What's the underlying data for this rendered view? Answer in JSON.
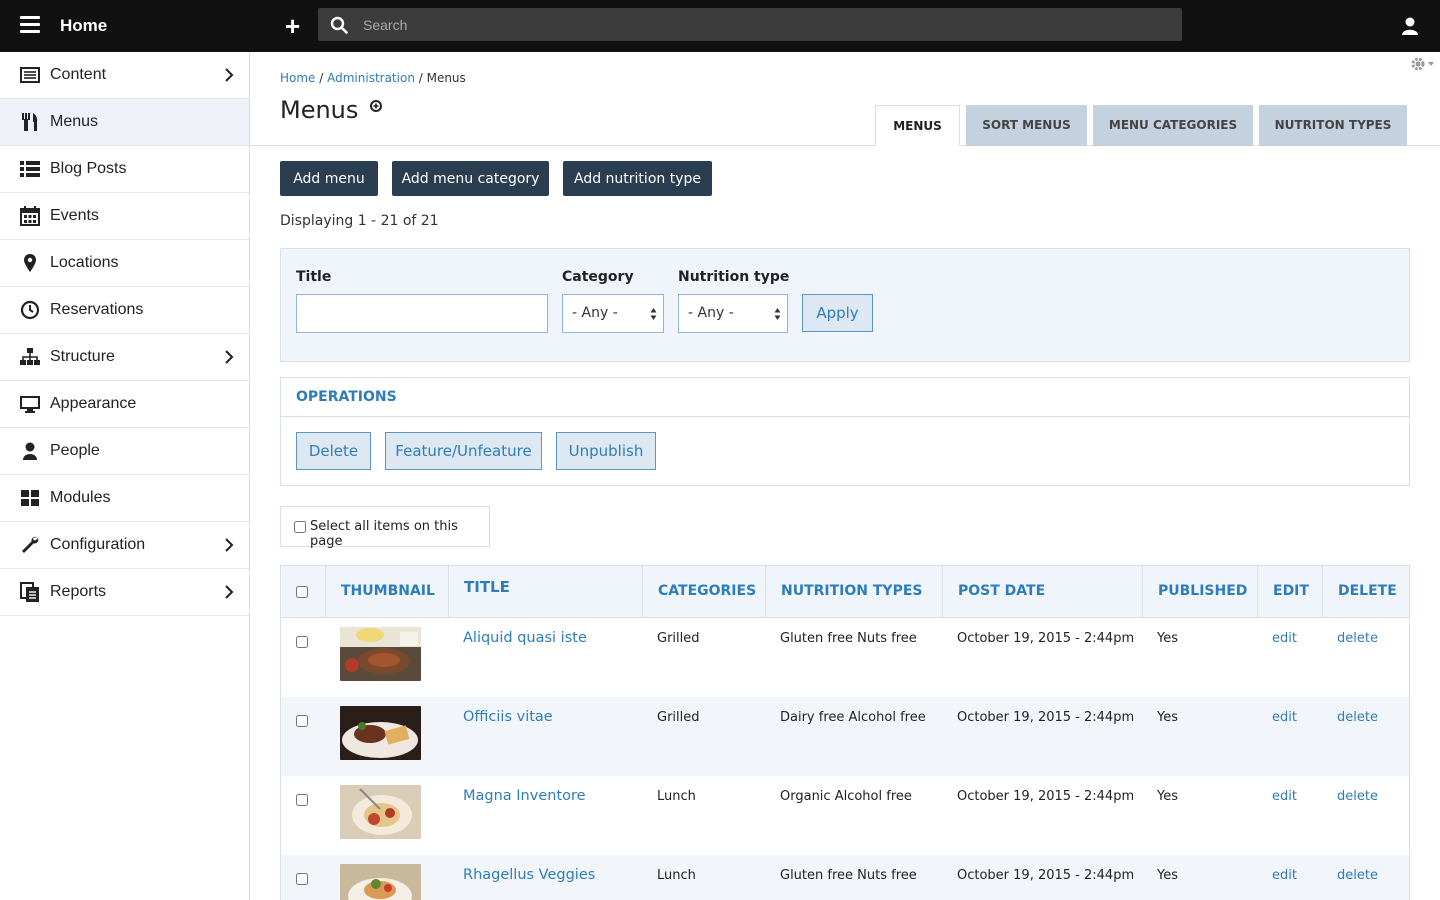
{
  "topbar": {
    "home_label": "Home",
    "search_placeholder": "Search"
  },
  "sidebar": {
    "items": [
      {
        "label": "Content",
        "icon": "content-icon",
        "has_children": true
      },
      {
        "label": "Menus",
        "icon": "menus-icon",
        "active": true
      },
      {
        "label": "Blog Posts",
        "icon": "list-icon"
      },
      {
        "label": "Events",
        "icon": "calendar-icon"
      },
      {
        "label": "Locations",
        "icon": "map-pin-icon"
      },
      {
        "label": "Reservations",
        "icon": "clock-icon"
      },
      {
        "label": "Structure",
        "icon": "sitemap-icon",
        "has_children": true
      },
      {
        "label": "Appearance",
        "icon": "monitor-icon"
      },
      {
        "label": "People",
        "icon": "person-icon"
      },
      {
        "label": "Modules",
        "icon": "modules-icon"
      },
      {
        "label": "Configuration",
        "icon": "wrench-icon",
        "has_children": true
      },
      {
        "label": "Reports",
        "icon": "reports-icon",
        "has_children": true
      }
    ]
  },
  "breadcrumb": {
    "home": "Home",
    "sep1": " / ",
    "admin": "Administration",
    "sep2": " / ",
    "current": "Menus"
  },
  "page_title": "Menus",
  "tabs": [
    {
      "label": "MENUS",
      "active": true
    },
    {
      "label": "SORT MENUS"
    },
    {
      "label": "MENU CATEGORIES"
    },
    {
      "label": "NUTRITON TYPES"
    }
  ],
  "actions": {
    "add_menu": "Add menu",
    "add_menu_category": "Add menu category",
    "add_nutrition_type": "Add nutrition type"
  },
  "displaying": "Displaying 1 - 21 of 21",
  "filters": {
    "title_label": "Title",
    "title_value": "",
    "category_label": "Category",
    "category_value": "- Any -",
    "nutrition_label": "Nutrition type",
    "nutrition_value": "- Any -",
    "apply": "Apply"
  },
  "operations": {
    "title": "OPERATIONS",
    "delete": "Delete",
    "feature": "Feature/Unfeature",
    "unpublish": "Unpublish"
  },
  "select_all": "Select all items on this page",
  "table": {
    "headers": {
      "thumbnail": "THUMBNAIL",
      "title": "TITLE",
      "categories": "CATEGORIES",
      "nutrition": "NUTRITION TYPES",
      "post_date": "POST DATE",
      "published": "PUBLISHED",
      "edit": "EDIT",
      "delete": "DELETE"
    },
    "rows": [
      {
        "title": "Aliquid quasi iste",
        "category": "Grilled",
        "nutrition": "Gluten free Nuts free",
        "date": "October 19, 2015 - 2:44pm",
        "published": "Yes",
        "edit": "edit",
        "delete": "delete"
      },
      {
        "title": "Officiis vitae",
        "category": "Grilled",
        "nutrition": "Dairy free Alcohol free",
        "date": "October 19, 2015 - 2:44pm",
        "published": "Yes",
        "edit": "edit",
        "delete": "delete"
      },
      {
        "title": "Magna Inventore",
        "category": "Lunch",
        "nutrition": "Organic Alcohol free",
        "date": "October 19, 2015 - 2:44pm",
        "published": "Yes",
        "edit": "edit",
        "delete": "delete"
      },
      {
        "title": "Rhagellus Veggies",
        "category": "Lunch",
        "nutrition": "Gluten free Nuts free",
        "date": "October 19, 2015 - 2:44pm",
        "published": "Yes",
        "edit": "edit",
        "delete": "delete"
      }
    ]
  }
}
